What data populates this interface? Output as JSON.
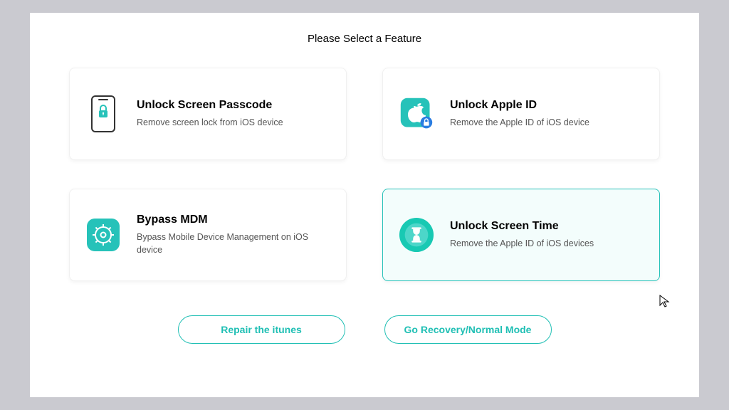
{
  "page_title": "Please Select a Feature",
  "features": [
    {
      "title": "Unlock Screen Passcode",
      "desc": "Remove screen lock from iOS device",
      "icon": "phone-lock-icon",
      "selected": false
    },
    {
      "title": "Unlock Apple ID",
      "desc": "Remove the Apple ID of iOS device",
      "icon": "apple-lock-icon",
      "selected": false
    },
    {
      "title": "Bypass MDM",
      "desc": "Bypass Mobile Device Management on iOS device",
      "icon": "gear-icon",
      "selected": false
    },
    {
      "title": "Unlock Screen Time",
      "desc": "Remove the Apple ID of iOS devices",
      "icon": "hourglass-icon",
      "selected": true
    }
  ],
  "buttons": {
    "repair": "Repair the itunes",
    "recovery": "Go Recovery/Normal Mode"
  },
  "colors": {
    "accent": "#26c2b9",
    "accent_dark": "#1fbfb4",
    "selected_bg": "#f3fdfc"
  }
}
